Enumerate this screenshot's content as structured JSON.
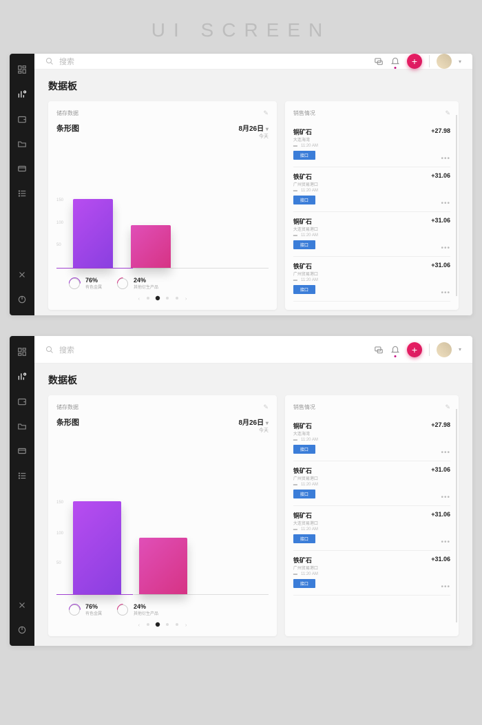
{
  "banner": "UI SCREEN",
  "search": {
    "placeholder": "搜索"
  },
  "page_title": "数据板",
  "sidebar": {
    "items": [
      {
        "name": "dashboard-icon"
      },
      {
        "name": "analytics-icon"
      },
      {
        "name": "wallet-icon"
      },
      {
        "name": "folder-icon"
      },
      {
        "name": "card-icon"
      },
      {
        "name": "list-icon"
      }
    ],
    "bottom": [
      {
        "name": "settings-icon"
      },
      {
        "name": "power-icon"
      }
    ]
  },
  "chart_panel": {
    "header": "储存数据",
    "title": "条形图",
    "date": "8月26日",
    "date_sub": "今天",
    "legend": [
      {
        "pct": "76%",
        "label": "有色金属"
      },
      {
        "pct": "24%",
        "label": "其他衍生产品"
      }
    ]
  },
  "chart_data": {
    "type": "bar",
    "categories": [
      "有色金属",
      "其他衍生产品"
    ],
    "values": [
      150,
      95
    ],
    "percentages": [
      76,
      24
    ],
    "ylim": [
      0,
      150
    ],
    "yticks": [
      50,
      100,
      150
    ],
    "title": "条形图",
    "xlabel": "",
    "ylabel": ""
  },
  "sales_panel": {
    "header": "销售情况",
    "button_label": "接口",
    "items": [
      {
        "name": "铜矿石",
        "sub": "大连海湾",
        "time": "11:20 AM",
        "amount": "+27.98"
      },
      {
        "name": "铁矿石",
        "sub": "广州贸易港口",
        "time": "11:20 AM",
        "amount": "+31.06"
      },
      {
        "name": "铜矿石",
        "sub": "大连贸易港口",
        "time": "11:20 AM",
        "amount": "+31.06"
      },
      {
        "name": "铁矿石",
        "sub": "广州贸易港口",
        "time": "11:20 AM",
        "amount": "+31.06"
      }
    ]
  }
}
